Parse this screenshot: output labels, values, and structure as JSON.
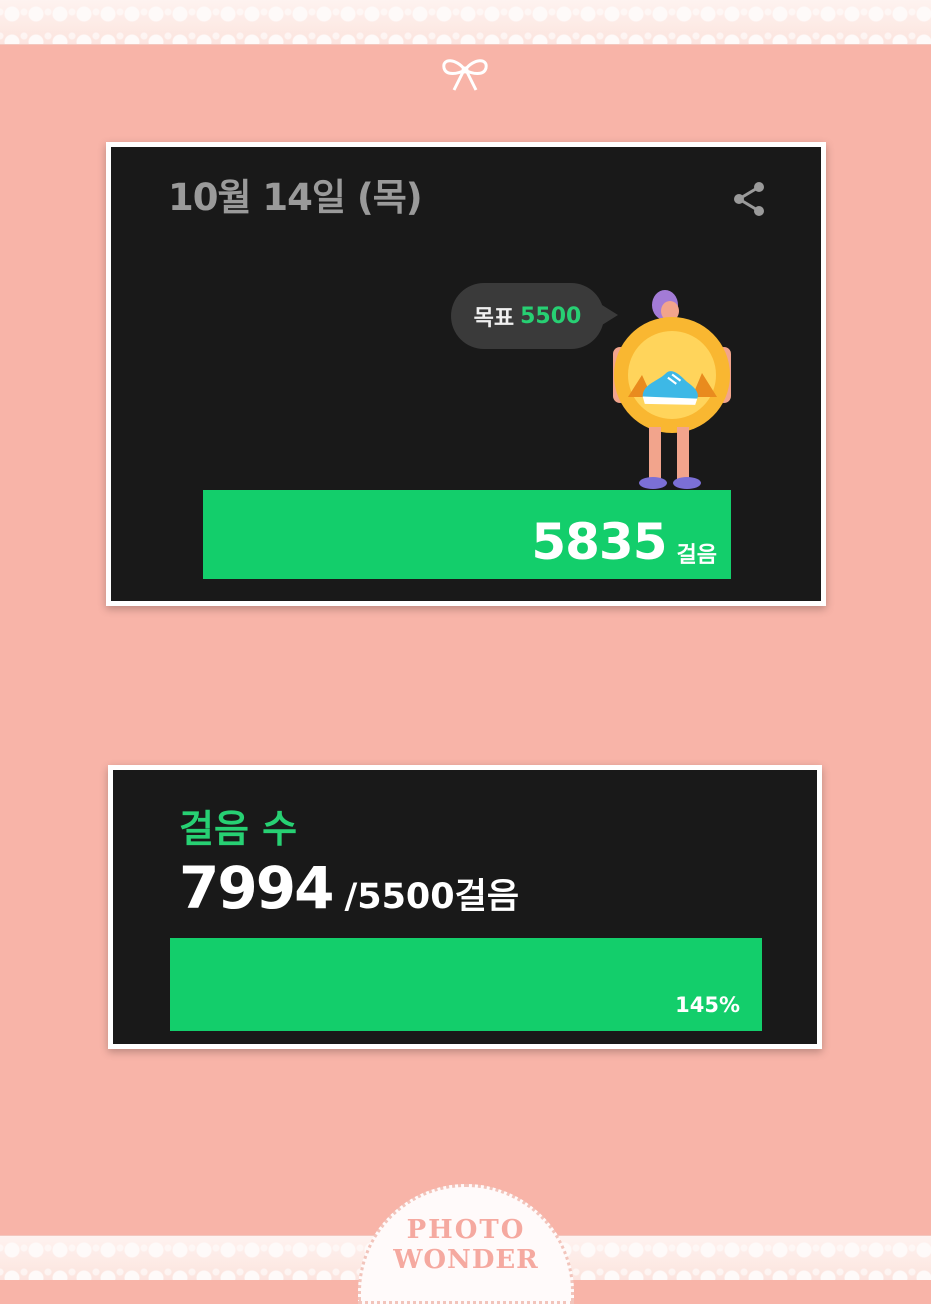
{
  "card1": {
    "date": "10월 14일 (목)",
    "goal_label": "목표",
    "goal_value": "5500",
    "steps": "5835",
    "steps_unit": "걸음"
  },
  "card2": {
    "label": "걸음 수",
    "steps": "7994",
    "goal_text": "/5500걸음",
    "percent": "145%",
    "progress_fraction": 1.0
  },
  "watermark": {
    "line1": "PHOTO",
    "line2": "WONDER"
  },
  "colors": {
    "background": "#f8b4a8",
    "card": "#191919",
    "accent_green": "#13ce6b",
    "goal_green": "#27d073",
    "date_gray": "#9a9a9a"
  },
  "icons": [
    "ribbon-icon",
    "share-icon",
    "walker-character-icon",
    "sneaker-icon"
  ]
}
